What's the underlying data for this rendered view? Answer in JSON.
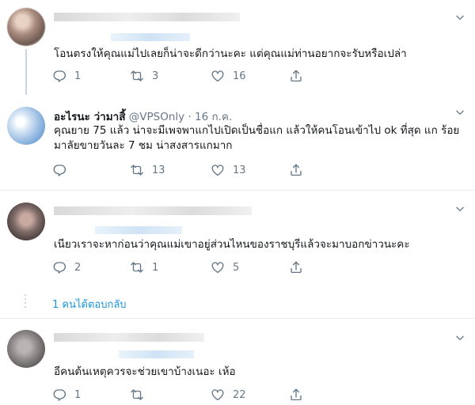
{
  "tweets": [
    {
      "name": "",
      "handle": "",
      "date": "",
      "text": "โอนตรงให้คุณแม่ไปเลยก็น่าจะดีกว่านะคะ แต่คุณแม่ท่านอยากจะรับหรือเปล่า",
      "replies": "1",
      "retweets": "3",
      "likes": "16"
    },
    {
      "name": "อะไรนะ ว่ามาสิ้",
      "handle": "@VPSOnly",
      "dot": "·",
      "date": "16 ก.ค.",
      "text": "คุณยาย 75 แล้ว น่าจะมีเพจพาแกไปเปิดเป็นชื่อแก แล้วให้คนโอนเข้าไป ok ที่สุด แก ร้อยมาลัยขายวันละ 7 ชม น่าสงสารแกมาก",
      "replies": "",
      "retweets": "13",
      "likes": "13"
    },
    {
      "name": "",
      "handle": "",
      "date": "",
      "text": "เนียวเราจะหาก่อนว่าคุณแม่เขาอยู่ส่วนไหนของราชบุรีแล้วจะมาบอกข่าวนะคะ",
      "replies": "2",
      "retweets": "1",
      "likes": "5",
      "more_replies": "1 คนได้ตอบกลับ"
    },
    {
      "name": "",
      "handle": "",
      "date": "",
      "text": "อีคนต้นเหตุควรจะช่วยเขาบ้างเนอะ เห้อ",
      "replies": "1",
      "retweets": "",
      "likes": "22"
    }
  ],
  "icons": {
    "reply": "reply-icon",
    "retweet": "retweet-icon",
    "like": "heart-icon",
    "share": "share-icon",
    "caret": "chevron-down-icon"
  },
  "colors": {
    "text": "#14171a",
    "secondary": "#657786",
    "link": "#1b95e0",
    "divider": "#e6ecf0"
  }
}
